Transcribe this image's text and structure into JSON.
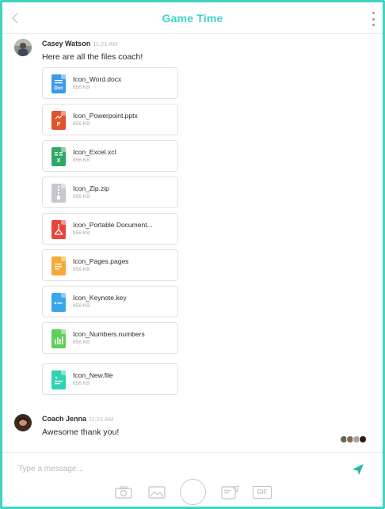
{
  "header": {
    "title": "Game Time"
  },
  "messages": [
    {
      "sender": "Casey Watson",
      "time": "11:21 AM",
      "text": "Here are all the files coach!"
    },
    {
      "sender": "Coach Jenna",
      "time": "11:21 AM",
      "text": "Awesome thank you!"
    }
  ],
  "files": [
    {
      "name": "Icon_Word.docx",
      "size": "856 KB",
      "icon": "word-doc-icon",
      "color": "#3e9be8",
      "glyph": "Doc"
    },
    {
      "name": "Icon_Powerpoint.pptx",
      "size": "856 KB",
      "icon": "powerpoint-icon",
      "color": "#e2532b",
      "glyph": "P"
    },
    {
      "name": "Icon_Excel.xcl",
      "size": "856 KB",
      "icon": "excel-icon",
      "color": "#2fa867",
      "glyph": "X"
    },
    {
      "name": "Icon_Zip.zip",
      "size": "856 KB",
      "icon": "zip-icon",
      "color": "#c5c8cf",
      "glyph": ""
    },
    {
      "name": "Icon_Portable Document...",
      "size": "856 KB",
      "icon": "pdf-icon",
      "color": "#e8453c",
      "glyph": ""
    },
    {
      "name": "Icon_Pages.pages",
      "size": "856 KB",
      "icon": "pages-icon",
      "color": "#f6a83a",
      "glyph": ""
    },
    {
      "name": "Icon_Keynote.key",
      "size": "856 KB",
      "icon": "keynote-icon",
      "color": "#3aa6ee",
      "glyph": ""
    },
    {
      "name": "Icon_Numbers.numbers",
      "size": "856 KB",
      "icon": "numbers-icon",
      "color": "#5dcf5a",
      "glyph": ""
    },
    {
      "name": "Icon_New.file",
      "size": "856 KB",
      "icon": "new-file-icon",
      "color": "#2ed3b0",
      "glyph": ""
    }
  ],
  "composer": {
    "placeholder": "Type a message…",
    "tools": [
      "camera-icon",
      "image-icon",
      "shutter-button",
      "sticker-icon",
      "gif-icon"
    ],
    "gif_label": "GIF"
  },
  "colors": {
    "accent": "#3fd3c2",
    "send": "#1fb9a3"
  }
}
